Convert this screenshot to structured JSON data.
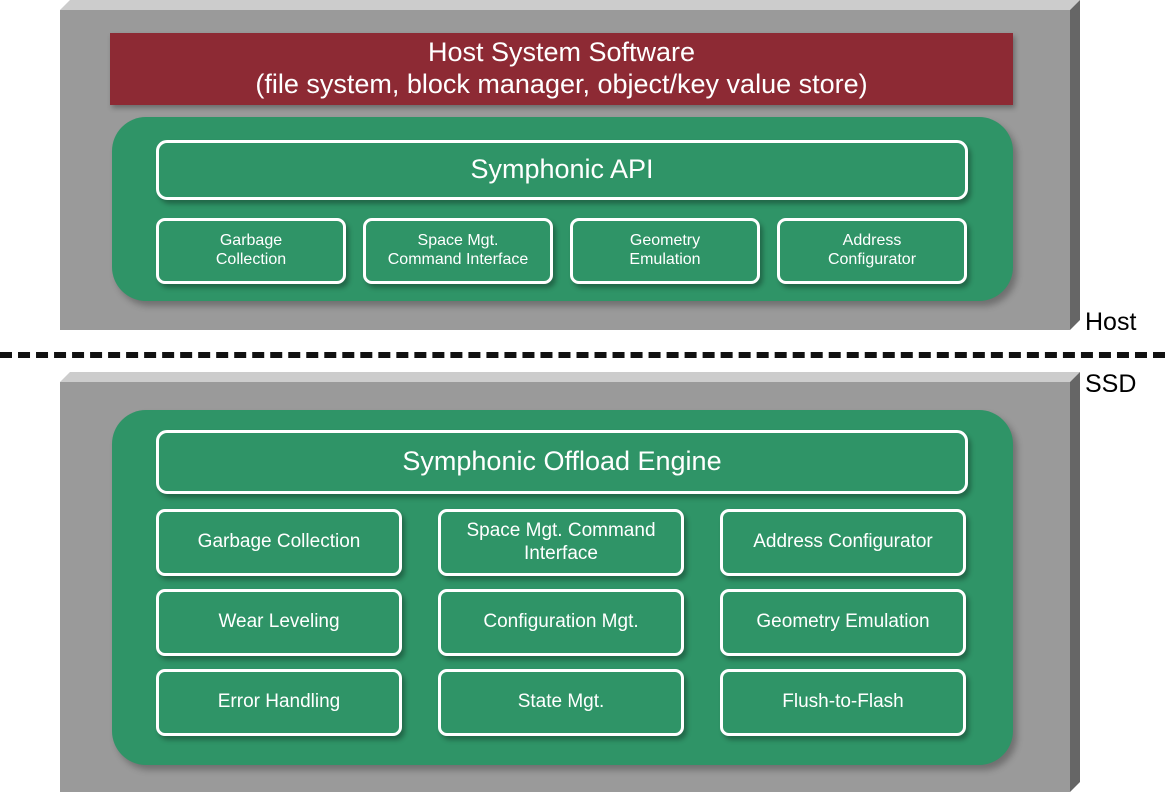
{
  "diagram": {
    "colors": {
      "slab_gray": "#9a9a9a",
      "slab_top_bevel": "#cccccc",
      "slab_right_bevel": "#666666",
      "banner_red": "#8d2a34",
      "panel_green": "#2f9467",
      "outline_white": "#ffffff",
      "divider_black": "#111111"
    },
    "side_labels": {
      "host": "Host",
      "ssd": "SSD"
    },
    "host_section": {
      "banner": {
        "line1": "Host System Software",
        "line2": "(file system, block manager, object/key value store)"
      },
      "api_title": "Symphonic API",
      "modules": [
        {
          "line1": "Garbage",
          "line2": "Collection"
        },
        {
          "line1": "Space Mgt.",
          "line2": "Command Interface"
        },
        {
          "line1": "Geometry",
          "line2": "Emulation"
        },
        {
          "line1": "Address",
          "line2": "Configurator"
        }
      ]
    },
    "ssd_section": {
      "engine_title": "Symphonic Offload Engine",
      "modules": [
        {
          "label": "Garbage Collection"
        },
        {
          "label": "Space Mgt. Command Interface"
        },
        {
          "label": "Address Configurator"
        },
        {
          "label": "Wear Leveling"
        },
        {
          "label": "Configuration Mgt."
        },
        {
          "label": "Geometry Emulation"
        },
        {
          "label": "Error Handling"
        },
        {
          "label": "State Mgt."
        },
        {
          "label": "Flush-to-Flash"
        }
      ]
    }
  }
}
